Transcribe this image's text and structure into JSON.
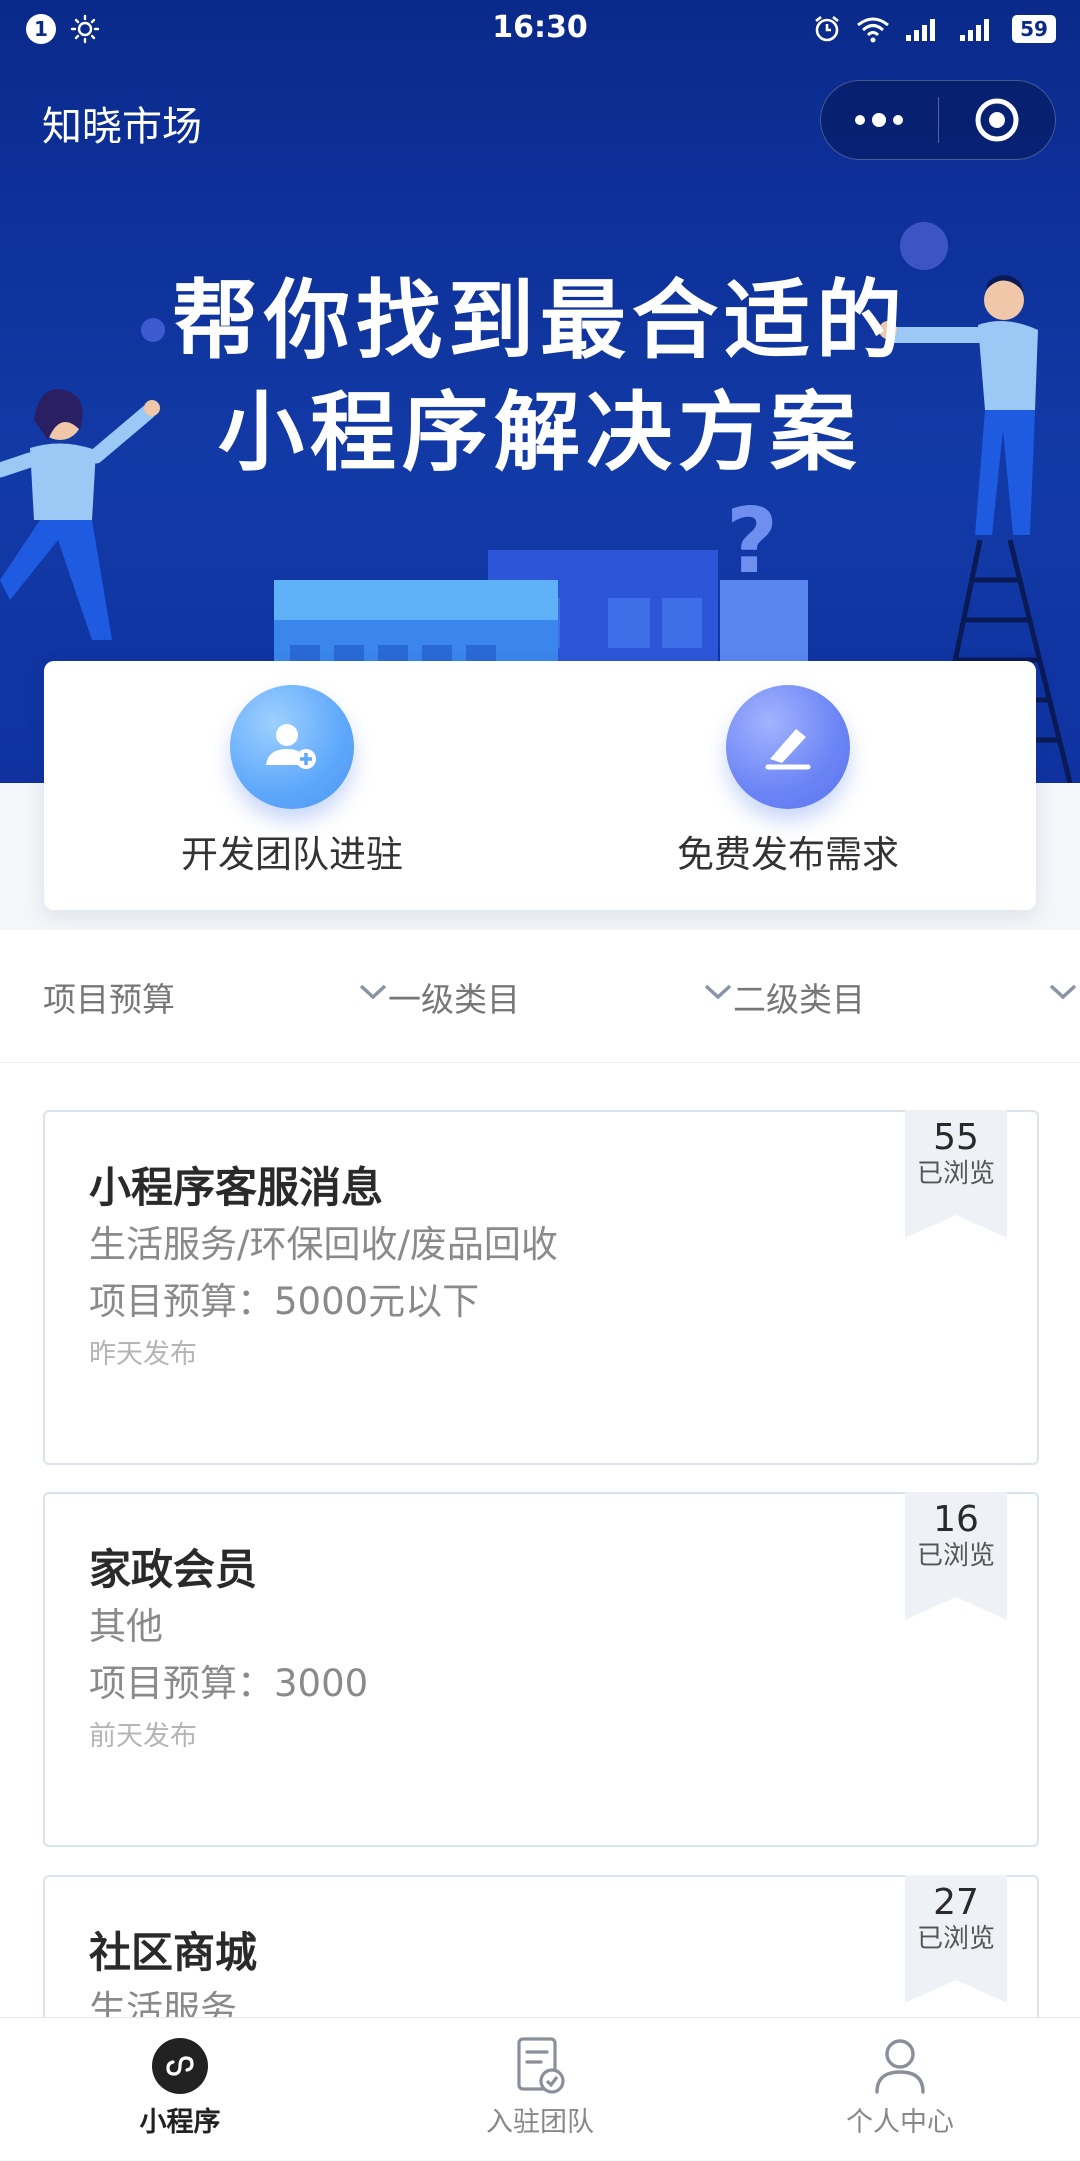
{
  "status_bar": {
    "notification_count": "1",
    "time": "16:30",
    "battery": "59"
  },
  "nav": {
    "title": "知晓市场"
  },
  "banner": {
    "title_line1": "帮你找到最合适的",
    "title_line2": "小程序解决方案",
    "question_mark": "?"
  },
  "actions": [
    {
      "label": "开发团队进驻",
      "icon": "add-user-icon"
    },
    {
      "label": "免费发布需求",
      "icon": "pen-icon"
    }
  ],
  "filters": [
    {
      "label": "项目预算"
    },
    {
      "label": "一级类目"
    },
    {
      "label": "二级类目"
    }
  ],
  "listings": [
    {
      "title": "小程序客服消息",
      "category": "生活服务/环保回收/废品回收",
      "budget": "项目预算：5000元以下",
      "time": "昨天发布",
      "views": "55",
      "views_label": "已浏览"
    },
    {
      "title": "家政会员",
      "category": "其他",
      "budget": "项目预算：3000",
      "time": "前天发布",
      "views": "16",
      "views_label": "已浏览"
    },
    {
      "title": "社区商城",
      "category": "生活服务",
      "budget": "",
      "time": "",
      "views": "27",
      "views_label": "已浏览"
    }
  ],
  "tabbar": [
    {
      "label": "小程序",
      "icon": "mini-program-icon",
      "active": true
    },
    {
      "label": "入驻团队",
      "icon": "document-check-icon",
      "active": false
    },
    {
      "label": "个人中心",
      "icon": "person-icon",
      "active": false
    }
  ],
  "colors": {
    "banner": "#0f32a0",
    "accent": "#4a95f1"
  }
}
